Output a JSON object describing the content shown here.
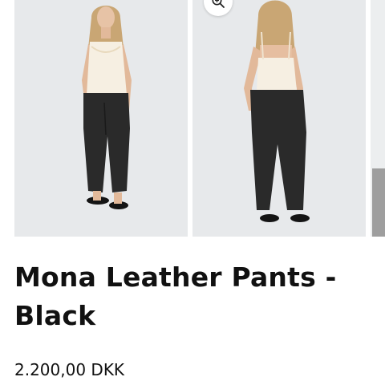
{
  "product": {
    "title": "Mona Leather Pants - Black",
    "price": "2.200,00 DKK"
  },
  "gallery": {
    "images": [
      {
        "view": "front",
        "icon": "product-photo-front"
      },
      {
        "view": "back",
        "icon": "product-photo-back"
      },
      {
        "view": "partial",
        "icon": "product-photo-next"
      }
    ],
    "zoom_icon": "zoom-in-icon"
  },
  "colors": {
    "background": "#ffffff",
    "text": "#111111",
    "photo_bg": "#e6e8ea"
  }
}
